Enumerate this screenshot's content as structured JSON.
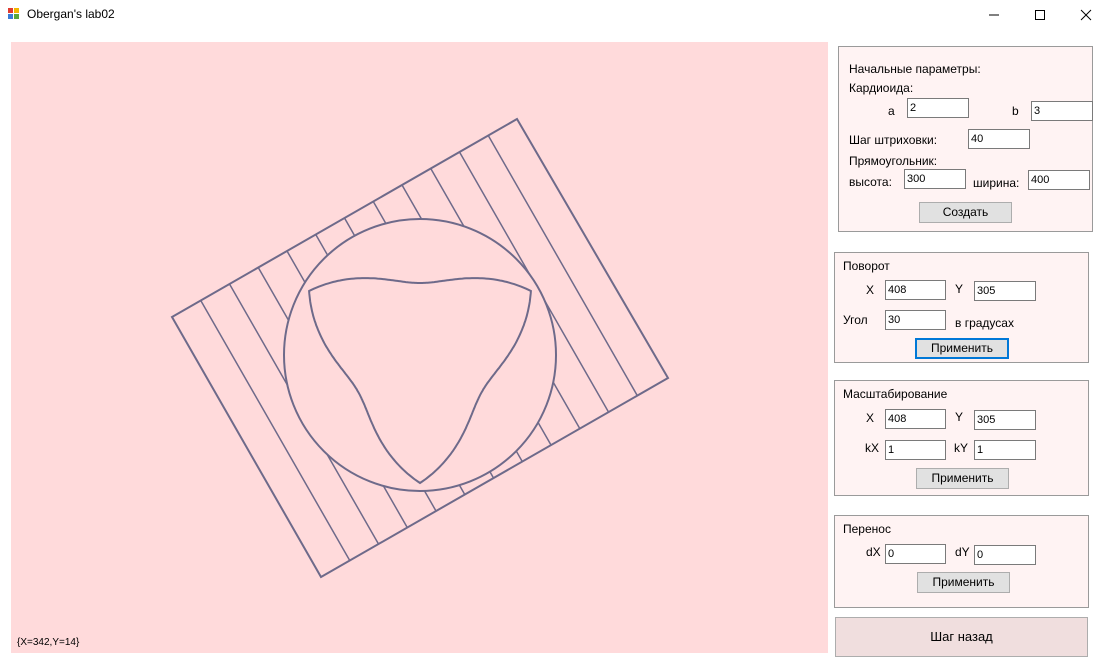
{
  "window": {
    "title": "Obergan's lab02",
    "minimize_icon": "minimize-icon",
    "maximize_icon": "maximize-icon",
    "close_icon": "close-icon"
  },
  "canvas": {
    "coords_text": "{X=342,Y=14}",
    "background": "#ffdadb",
    "stroke": "#6e6a8a"
  },
  "params": {
    "title": "Начальные параметры:",
    "cardioid_label": "Кардиоида:",
    "a_label": "a",
    "a_value": "2",
    "b_label": "b",
    "b_value": "3",
    "hatch_label": "Шаг штриховки:",
    "hatch_value": "40",
    "rect_label": "Прямоугольник:",
    "height_label": "высота:",
    "height_value": "300",
    "width_label": "ширина:",
    "width_value": "400",
    "create_button": "Создать"
  },
  "rotate": {
    "title": "Поворот",
    "x_label": "X",
    "x_value": "408",
    "y_label": "Y",
    "y_value": "305",
    "angle_label": "Угол",
    "angle_value": "30",
    "unit_label": "в градусах",
    "apply_button": "Применить"
  },
  "scale": {
    "title": "Масштабирование",
    "x_label": "X",
    "x_value": "408",
    "y_label": "Y",
    "y_value": "305",
    "kx_label": "kX",
    "kx_value": "1",
    "ky_label": "kY",
    "ky_value": "1",
    "apply_button": "Применить"
  },
  "translate": {
    "title": "Перенос",
    "dx_label": "dX",
    "dx_value": "0",
    "dy_label": "dY",
    "dy_value": "0",
    "apply_button": "Применить"
  },
  "undo_button": "Шаг назад"
}
